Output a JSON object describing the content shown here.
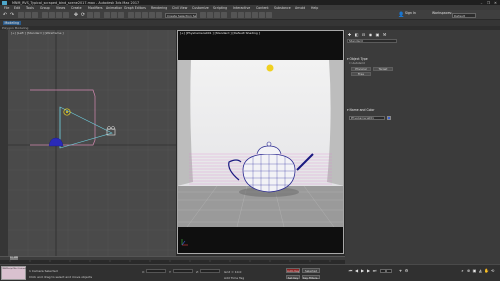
{
  "window": {
    "title": "MNM_RVS_Typical_scraped_bind_scene2017.max - Autodesk 3ds Max 2017",
    "controls": [
      "–",
      "❐",
      "✕"
    ]
  },
  "menubar": {
    "items": [
      "File",
      "Edit",
      "Tools",
      "Group",
      "Views",
      "Create",
      "Modifiers",
      "Animation",
      "Graph Editors",
      "Rendering",
      "Civil View",
      "Customize",
      "Scripting",
      "Interactive",
      "Content",
      "Substance",
      "Arnold",
      "Help"
    ]
  },
  "toolbar": {
    "selection_dropdown": "Create Selection Se",
    "signin": "Sign In",
    "workspace_label": "Workspaces:",
    "workspace_dropdown": "Default"
  },
  "ribbon": {
    "active_tab": "Modeling",
    "sub_label": "Polygon Modeling"
  },
  "viewports": {
    "left_label": "[+] [Left ] [Standard ] [Wireframe ]",
    "main_label": "[+] [PhysCamera001 ] [Standard ] [Default Shading ]"
  },
  "command_panel": {
    "category_dropdown": "Standard",
    "object_type_header": "Object Type",
    "autogrid": "AutoGrid",
    "buttons": [
      "Physical",
      "Target",
      "Free"
    ],
    "name_color_header": "Name and Color",
    "name_value": "PhysCamera001"
  },
  "timeline": {
    "current": "0 / 100"
  },
  "status": {
    "listener": "MAXScript Mini Listener",
    "selected": "1 Camera Selected",
    "prompt": "Click and drag to select and move objects",
    "x_label": "X:",
    "y_label": "Y:",
    "z_label": "Z:",
    "x_value": "",
    "y_value": "",
    "z_value": "",
    "grid": "Grid = 10.0",
    "add_time_tag": "Add Time Tag",
    "auto_key": "Auto Key",
    "set_key": "Set Key",
    "selected_dropdown": "Selected",
    "key_filters": "Key Filters...",
    "frame": "0"
  },
  "colors": {
    "accent": "#2a5a8a",
    "teapot_wire": "#3a3aa8",
    "light_gizmo": "#e8d020",
    "camera_gizmo": "#6fd0e0",
    "selection_frame": "#d48ab2"
  }
}
